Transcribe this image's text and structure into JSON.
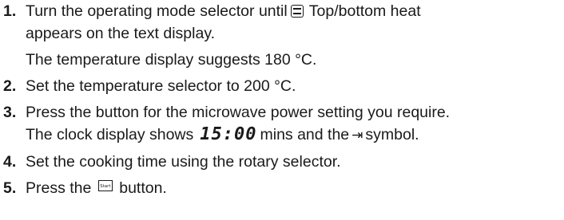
{
  "steps": [
    {
      "number": "1.",
      "line1_before": "Turn the operating mode selector until",
      "icon_name": "top-bottom-heat-icon",
      "line1_after": "Top/bottom heat",
      "line2": "appears on the text display.",
      "note": "The temperature display suggests 180 °C."
    },
    {
      "number": "2.",
      "text": "Set the temperature selector to 200 °C."
    },
    {
      "number": "3.",
      "line1": "Press the button for the microwave power setting you require.",
      "line2_before": "The clock display shows",
      "clock_value": "15:00",
      "line2_middle": "mins and the",
      "arrow_icon_name": "arrow-to-bar-icon",
      "arrow_glyph": "⇥",
      "line2_after": "symbol."
    },
    {
      "number": "4.",
      "text": "Set the cooking time using the rotary selector."
    },
    {
      "number": "5.",
      "text_before": "Press the",
      "start_icon_name": "start-button-icon",
      "start_label": "Start",
      "text_after": "button."
    }
  ]
}
